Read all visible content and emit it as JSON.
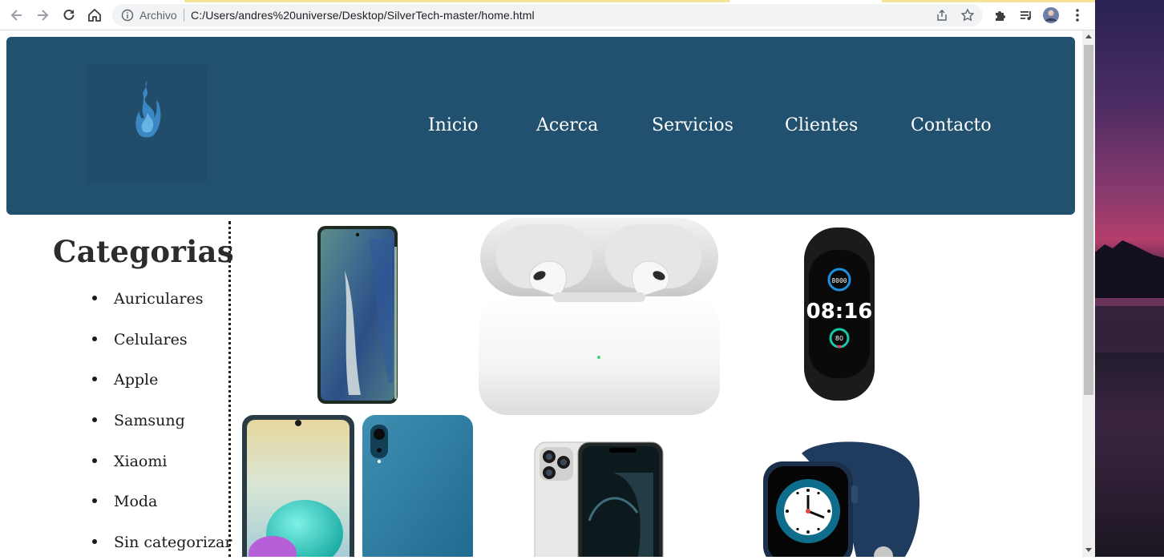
{
  "browser": {
    "scheme_label": "Archivo",
    "url": "C:/Users/andres%20universe/Desktop/SilverTech-master/home.html"
  },
  "header": {
    "nav": [
      "Inicio",
      "Acerca",
      "Servicios",
      "Clientes",
      "Contacto"
    ],
    "bg_color": "#22506f"
  },
  "sidebar": {
    "title": "Categorias",
    "items": [
      "Auriculares",
      "Celulares",
      "Apple",
      "Samsung",
      "Xiaomi",
      "Moda",
      "Sin categorizar"
    ]
  },
  "products": [
    {
      "icon": "samsung-galaxy-note-phone"
    },
    {
      "icon": "airpods-pro-earbuds"
    },
    {
      "icon": "xiaomi-mi-band-smartwatch"
    },
    {
      "icon": "samsung-galaxy-a02-phone"
    },
    {
      "icon": "iphone-12-pro-phone"
    },
    {
      "icon": "apple-watch-smartwatch"
    }
  ]
}
